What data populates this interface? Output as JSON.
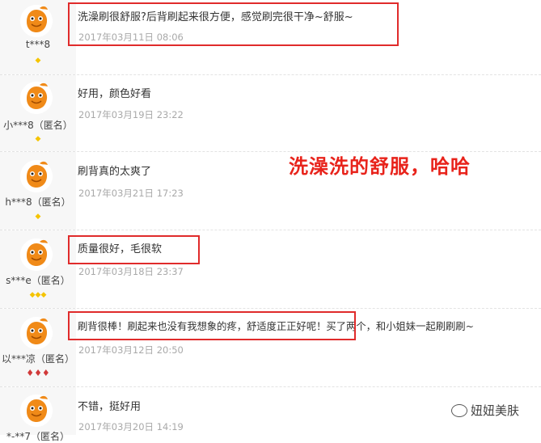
{
  "colors": {
    "highlight_box": "#e02b2b",
    "overlay_text": "#e8231b",
    "date_text": "#a9a9a9",
    "level_gold": "#f5c400",
    "level_red": "#d13a3a"
  },
  "reviews": [
    {
      "user": "t***8",
      "text": "洗澡刷很舒服?后背刷起来很方便，感觉刷完很干净~舒服~",
      "date": "2017年03月11日  08:06",
      "level": "◆",
      "level_color": "gold"
    },
    {
      "user": "小***8（匿名）",
      "text": "好用，颜色好看",
      "date": "2017年03月19日  23:22",
      "level": "◆",
      "level_color": "gold"
    },
    {
      "user": "h***8（匿名）",
      "text": "刷背真的太爽了",
      "date": "2017年03月21日  17:23",
      "level": "◆",
      "level_color": "gold"
    },
    {
      "user": "s***e（匿名）",
      "text": "质量很好，毛很软",
      "date": "2017年03月18日  23:37",
      "level": "◆◆◆",
      "level_color": "gold"
    },
    {
      "user": "以***凉（匿名）",
      "text": "刷背很棒！刷起来也没有我想象的疼，舒适度正正好呢！买了两个，和小姐妹一起刷刷刷~",
      "date": "2017年03月12日  20:50",
      "level": "♦♦♦",
      "level_color": "red"
    },
    {
      "user": "*-**7（匿名）",
      "text": "不错，挺好用",
      "date": "2017年03月20日  14:19",
      "level": "",
      "level_color": "gold"
    }
  ],
  "overlay_caption": "洗澡洗的舒服，哈哈",
  "watermark": "妞妞美肤"
}
